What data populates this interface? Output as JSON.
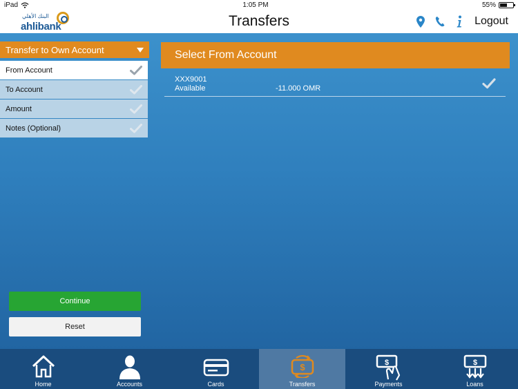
{
  "status_bar": {
    "device": "iPad",
    "time": "1:05 PM",
    "battery": "55%",
    "battery_level": 0.55
  },
  "header": {
    "logo_arabic": "البنك الأهلي",
    "logo_name": "ahlibank",
    "title": "Transfers",
    "logout_label": "Logout",
    "icons": [
      "location-pin-icon",
      "phone-icon",
      "info-icon"
    ]
  },
  "transfer_type": {
    "selected": "Transfer to Own Account"
  },
  "steps": [
    {
      "label": "From Account",
      "active": true
    },
    {
      "label": "To Account",
      "active": false
    },
    {
      "label": "Amount",
      "active": false
    },
    {
      "label": "Notes (Optional)",
      "active": false
    }
  ],
  "buttons": {
    "continue_label": "Continue",
    "reset_label": "Reset"
  },
  "select_from": {
    "heading": "Select From Account",
    "accounts": [
      {
        "number": "XXX9001",
        "available_label": "Available",
        "amount": "-11.000 OMR"
      }
    ]
  },
  "tabs": [
    {
      "label": "Home",
      "icon": "home-icon"
    },
    {
      "label": "Accounts",
      "icon": "user-icon"
    },
    {
      "label": "Cards",
      "icon": "card-icon"
    },
    {
      "label": "Transfers",
      "icon": "transfer-icon",
      "active": true
    },
    {
      "label": "Payments",
      "icon": "payment-icon"
    },
    {
      "label": "Loans",
      "icon": "loan-icon"
    }
  ],
  "colors": {
    "accent_orange": "#e08a1f",
    "continue_green": "#27a533",
    "brand_blue": "#1d5a96"
  }
}
